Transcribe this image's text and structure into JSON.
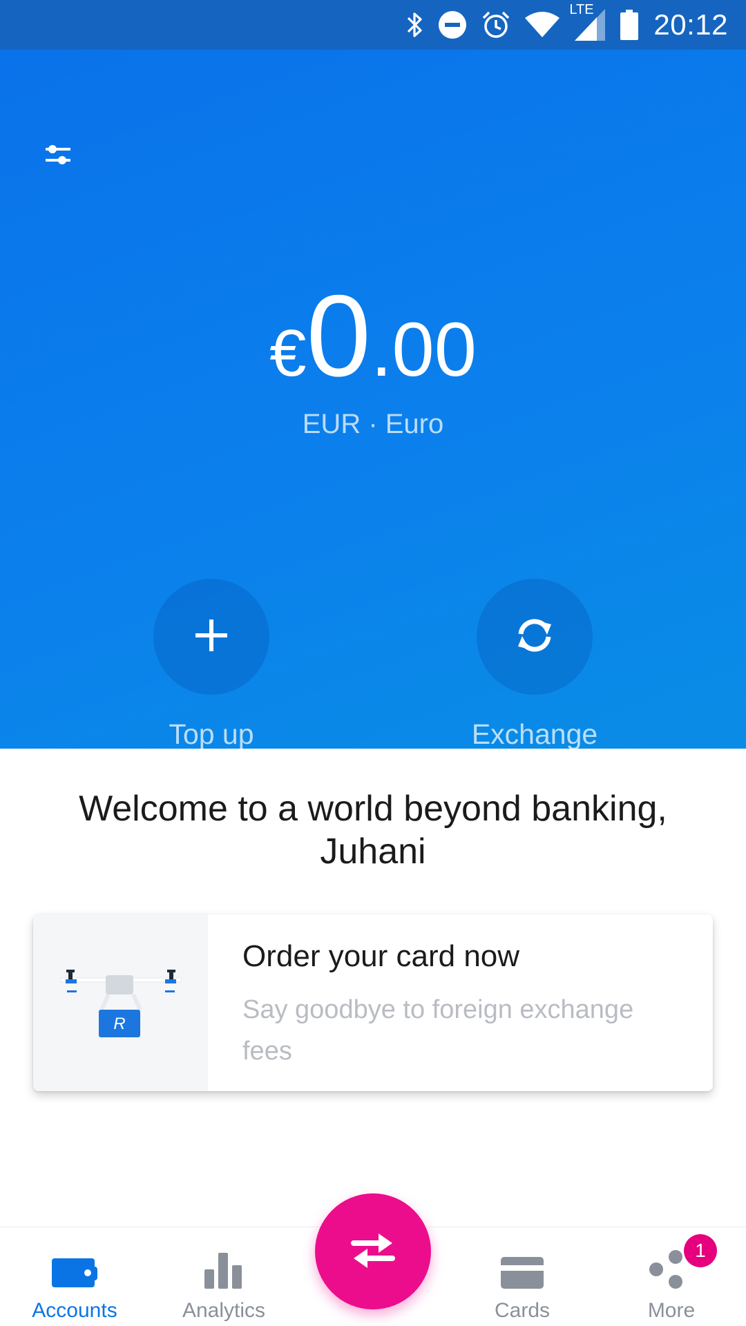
{
  "status_bar": {
    "network_label": "LTE",
    "time": "20:12",
    "icons": [
      "bluetooth-icon",
      "do-not-disturb-icon",
      "alarm-icon",
      "wifi-icon",
      "signal-icon",
      "battery-icon"
    ]
  },
  "header": {
    "settings_icon": "sliders-icon"
  },
  "balance": {
    "currency_symbol": "€",
    "integer": "0",
    "decimal": ".00",
    "currency_label": "EUR · Euro"
  },
  "actions": [
    {
      "label": "Top up",
      "icon": "plus-icon"
    },
    {
      "label": "Exchange",
      "icon": "refresh-icon"
    }
  ],
  "welcome": {
    "text": "Welcome to a world beyond banking, Juhani"
  },
  "promo": {
    "title": "Order your card now",
    "subtitle": "Say goodbye to foreign exchange fees",
    "illustration_text": "R"
  },
  "bottom_nav": {
    "items": [
      {
        "label": "Accounts",
        "icon": "wallet-icon",
        "active": true
      },
      {
        "label": "Analytics",
        "icon": "bar-chart-icon",
        "active": false
      },
      {
        "label": "Cards",
        "icon": "card-icon",
        "active": false
      },
      {
        "label": "More",
        "icon": "more-dots-icon",
        "active": false,
        "badge": "1"
      }
    ],
    "fab_icon": "transfer-arrows-icon"
  },
  "colors": {
    "status_bar": "#1565c0",
    "hero_start": "#0a72ea",
    "hero_end": "#0a8de6",
    "accent": "#0b74e5",
    "fab": "#ec0d8c",
    "badge": "#e6007e"
  }
}
